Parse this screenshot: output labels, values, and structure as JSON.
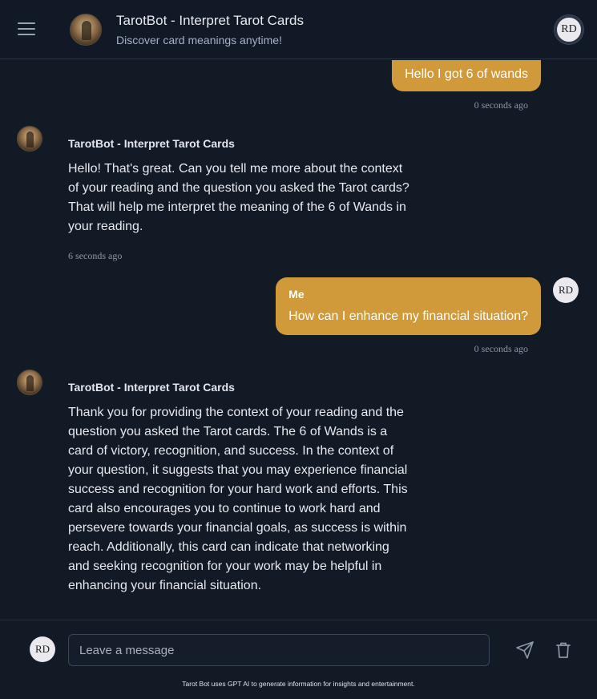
{
  "header": {
    "title": "TarotBot - Interpret Tarot Cards",
    "subtitle": "Discover card meanings anytime!",
    "user_initials": "RD"
  },
  "messages": [
    {
      "role": "user",
      "text": "Hello I got 6 of wands",
      "time": "0 seconds ago"
    },
    {
      "role": "bot",
      "name": "TarotBot - Interpret Tarot Cards",
      "text": "Hello! That's great. Can you tell me more about the context of your reading and the question you asked the Tarot cards? That will help me interpret the meaning of the 6 of Wands in your reading.",
      "time": "6 seconds ago"
    },
    {
      "role": "user",
      "name": "Me",
      "initials": "RD",
      "text": "How can I enhance my financial situation?",
      "time": "0 seconds ago"
    },
    {
      "role": "bot",
      "name": "TarotBot - Interpret Tarot Cards",
      "text": "Thank you for providing the context of your reading and the question you asked the Tarot cards. The 6 of Wands is a card of victory, recognition, and success. In the context of your question, it suggests that you may experience financial success and recognition for your hard work and efforts. This card also encourages you to continue to work hard and persevere towards your financial goals, as success is within reach. Additionally, this card can indicate that networking and seeking recognition for your work may be helpful in enhancing your financial situation."
    }
  ],
  "footer": {
    "user_initials": "RD",
    "input_placeholder": "Leave a message",
    "disclaimer": "Tarot Bot uses GPT AI to generate information for insights and entertainment."
  },
  "icons": {
    "menu": "menu-icon",
    "send": "send-icon",
    "trash": "trash-icon"
  },
  "colors": {
    "background": "#121a26",
    "user_bubble": "#d09a3a"
  }
}
